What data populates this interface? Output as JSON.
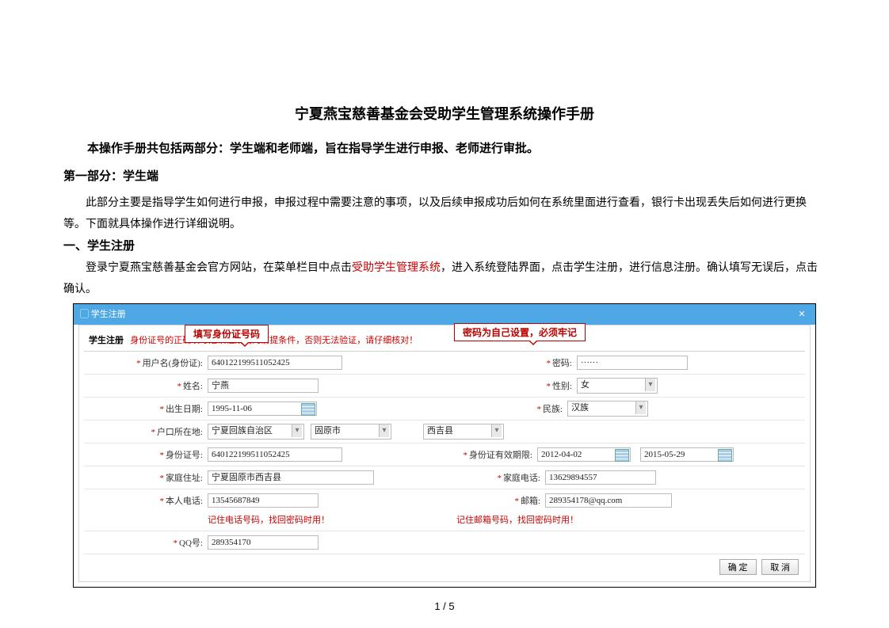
{
  "doc": {
    "title": "宁夏燕宝慈善基金会受助学生管理系统操作手册",
    "intro": "本操作手册共包括两部分：学生端和老师端，旨在指导学生进行申报、老师进行审批。",
    "part1_heading": "第一部分：学生端",
    "part1_para": "此部分主要是指导学生如何进行申报，申报过程中需要注意的事项，以及后续申报成功后如何在系统里面进行查看，银行卡出现丢失后如何进行更换等。下面就具体操作进行详细说明。",
    "sec1_heading": "一、学生注册",
    "sec1_para_pre": "登录宁夏燕宝慈善基金会官方网站，在菜单栏目中点击",
    "sec1_para_link": "受助学生管理系统",
    "sec1_para_post": "，进入系统登陆界面，点击学生注册，进行信息注册。确认填写无误后，点击确认。",
    "page_number": "1 / 5"
  },
  "shot": {
    "window_title": "▢ 学生注册",
    "window_close": "✕",
    "reg_label": "学生注册",
    "reg_redtext": "身份证号的正确填写是认证成功的前提条件，否则无法验证，请仔细核对！",
    "annot1": "填写身份证号码",
    "annot2": "密码为自己设置，必须牢记",
    "labels": {
      "user": "用户名(身份证):",
      "pwd": "密码:",
      "name": "姓名:",
      "sex": "性别:",
      "birth": "出生日期:",
      "nation": "民族:",
      "hukou": "户口所在地:",
      "idno": "身份证号:",
      "idvalid": "身份证有效期限:",
      "addr": "家庭住址:",
      "home_tel": "家庭电话:",
      "self_tel": "本人电话:",
      "email": "邮箱:",
      "qq": "QQ号:"
    },
    "values": {
      "user": "640122199511052425",
      "pwd": "······",
      "name": "宁燕",
      "sex": "女",
      "birth": "1995-11-06",
      "nation": "汉族",
      "region1": "宁夏回族自治区",
      "region2": "固原市",
      "region3": "西吉县",
      "idno": "640122199511052425",
      "idvalid_from": "2012-04-02",
      "idvalid_to": "2015-05-29",
      "addr": "宁夏固原市西吉县",
      "home_tel": "13629894557",
      "self_tel": "13545687849",
      "email": "289354178@qq.com",
      "qq": "289354170"
    },
    "hints": {
      "phone": "记住电话号码，找回密码时用！",
      "email": "记住邮箱号码，找回密码时用！"
    },
    "buttons": {
      "ok": "确 定",
      "cancel": "取 消"
    }
  }
}
